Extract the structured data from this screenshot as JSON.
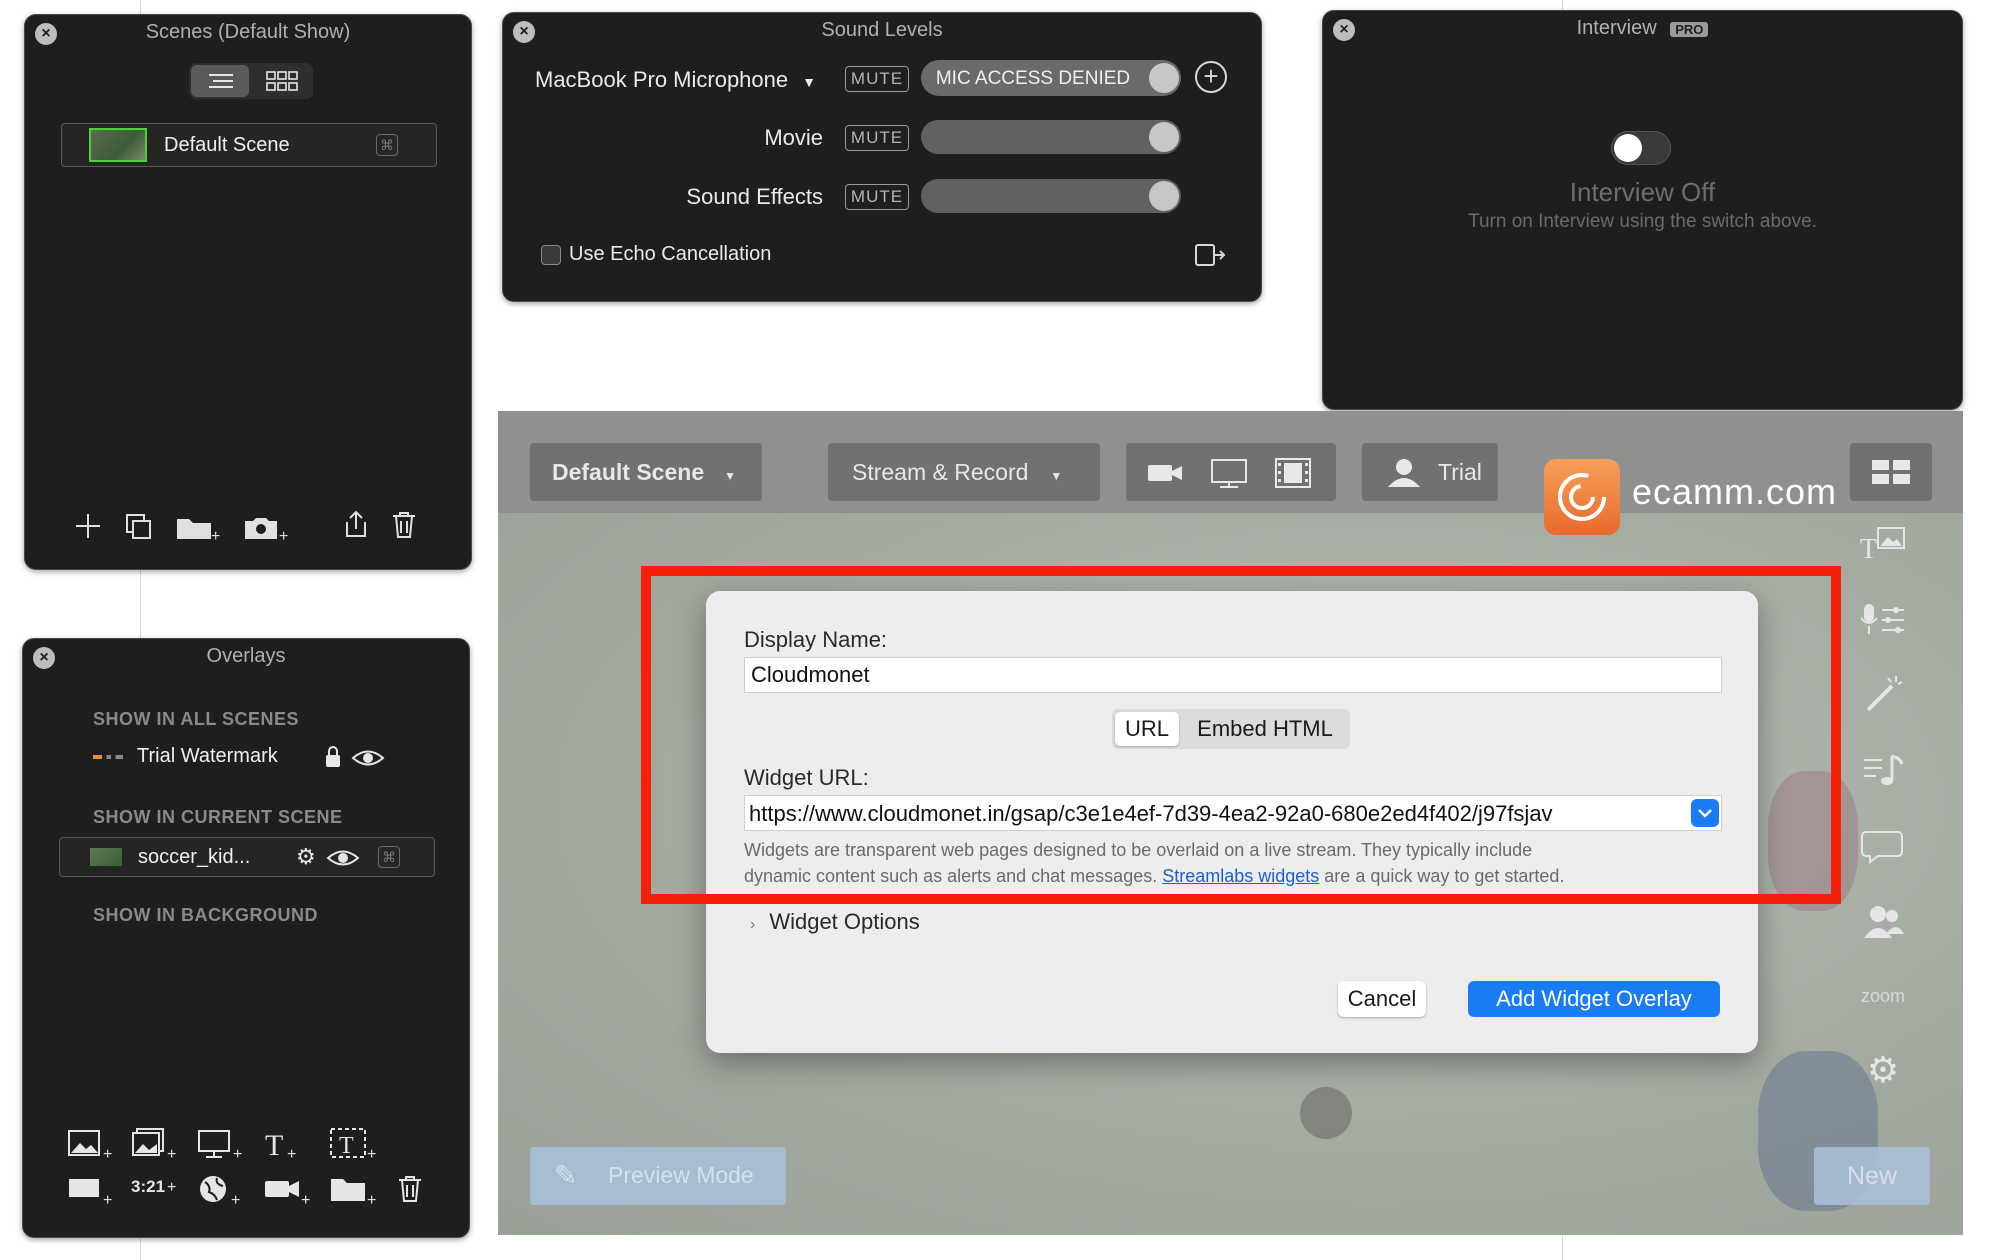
{
  "scenes_panel": {
    "title": "Scenes (Default Show)",
    "scene_name": "Default Scene"
  },
  "sound_panel": {
    "title": "Sound Levels",
    "mic_name": "MacBook Pro Microphone",
    "mute_label": "MUTE",
    "mic_status": "MIC ACCESS DENIED",
    "rows": [
      {
        "label": "Movie",
        "level": 0.95
      },
      {
        "label": "Sound Effects",
        "level": 0.95
      }
    ],
    "echo_label": "Use Echo Cancellation",
    "echo_checked": false
  },
  "interview_panel": {
    "title": "Interview",
    "badge": "PRO",
    "status": "Interview Off",
    "hint": "Turn on Interview using the switch above."
  },
  "overlays_panel": {
    "title": "Overlays",
    "section_all": "SHOW IN ALL SCENES",
    "watermark_label": "Trial Watermark",
    "section_current": "SHOW IN CURRENT SCENE",
    "current_item": "soccer_kid...",
    "section_background": "SHOW IN BACKGROUND",
    "timer_label": "3:21"
  },
  "main": {
    "scene_button": "Default Scene",
    "stream_button": "Stream & Record",
    "trial_button": "Trial",
    "brand": "ecamm.com",
    "preview_mode": "Preview Mode",
    "new_button": "New",
    "zoom_label": "zoom"
  },
  "dialog": {
    "display_name_label": "Display Name:",
    "display_name_value": "Cloudmonet",
    "seg_url": "URL",
    "seg_embed": "Embed HTML",
    "widget_url_label": "Widget URL:",
    "widget_url_value": "https://www.cloudmonet.in/gsap/c3e1e4ef-7d39-4ea2-92a0-680e2ed4f402/j97fsjav",
    "desc_1": "Widgets are transparent web pages designed to be overlaid on a live stream. They typically include",
    "desc_2a": "dynamic content such as alerts and chat messages. ",
    "desc_link": "Streamlabs widgets",
    "desc_2b": " are a quick way to get started.",
    "options_label": "Widget Options",
    "cancel": "Cancel",
    "add": "Add Widget Overlay"
  },
  "colors": {
    "accent_blue": "#1a7cf5",
    "highlight_red": "#f5200a",
    "panel_bg": "#1e1e1e",
    "link": "#1a5fd6"
  }
}
